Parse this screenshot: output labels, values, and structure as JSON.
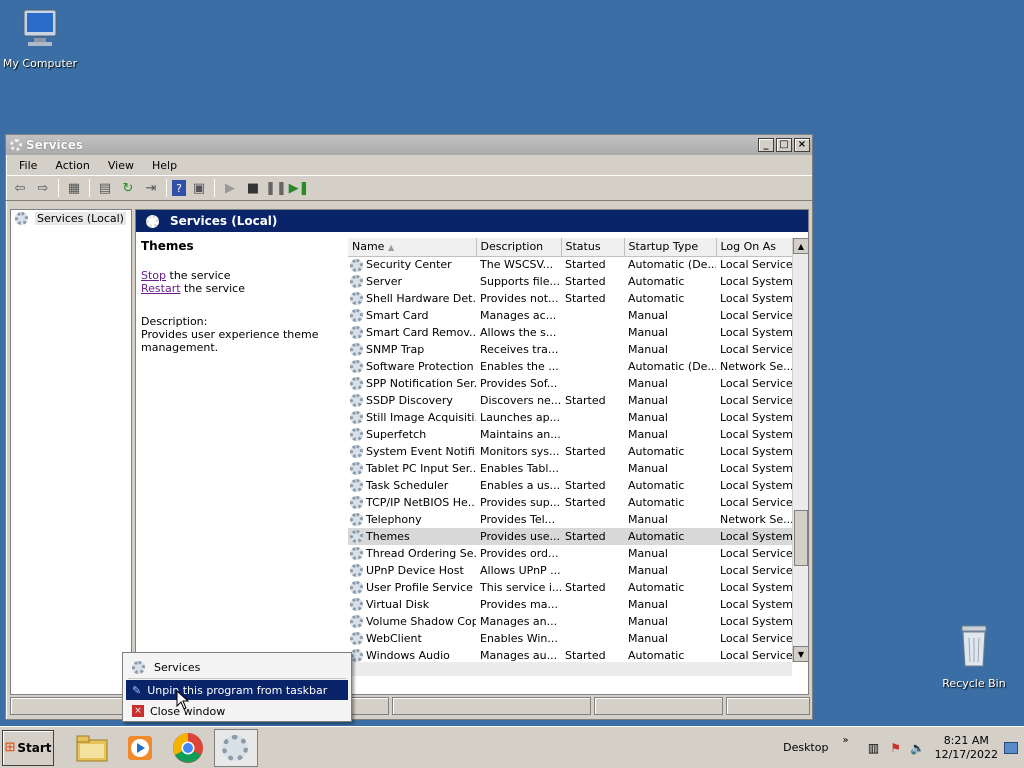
{
  "desktop": {
    "icons": [
      {
        "label": "My Computer",
        "icon": "computer-icon"
      },
      {
        "label": "Recycle Bin",
        "icon": "recycle-bin-icon"
      }
    ]
  },
  "window": {
    "title": "Services",
    "menu": [
      "File",
      "Action",
      "View",
      "Help"
    ],
    "tree_root": "Services (Local)",
    "header": "Services (Local)",
    "ext": {
      "selected_name": "Themes",
      "stop_link": "Stop",
      "stop_rest": " the service",
      "restart_link": "Restart",
      "restart_rest": " the service",
      "desc_label": "Description:",
      "desc_text": "Provides user experience theme management."
    },
    "columns": [
      "Name",
      "Description",
      "Status",
      "Startup Type",
      "Log On As"
    ],
    "rows": [
      {
        "name": "Security Center",
        "desc": "The WSCSV...",
        "status": "Started",
        "startup": "Automatic (De...",
        "logon": "Local Service"
      },
      {
        "name": "Server",
        "desc": "Supports file...",
        "status": "Started",
        "startup": "Automatic",
        "logon": "Local System"
      },
      {
        "name": "Shell Hardware Det...",
        "desc": "Provides not...",
        "status": "Started",
        "startup": "Automatic",
        "logon": "Local System"
      },
      {
        "name": "Smart Card",
        "desc": "Manages ac...",
        "status": "",
        "startup": "Manual",
        "logon": "Local Service"
      },
      {
        "name": "Smart Card Remov...",
        "desc": "Allows the s...",
        "status": "",
        "startup": "Manual",
        "logon": "Local System"
      },
      {
        "name": "SNMP Trap",
        "desc": "Receives tra...",
        "status": "",
        "startup": "Manual",
        "logon": "Local Service"
      },
      {
        "name": "Software Protection",
        "desc": "Enables the ...",
        "status": "",
        "startup": "Automatic (De...",
        "logon": "Network Se..."
      },
      {
        "name": "SPP Notification Ser...",
        "desc": "Provides Sof...",
        "status": "",
        "startup": "Manual",
        "logon": "Local Service"
      },
      {
        "name": "SSDP Discovery",
        "desc": "Discovers ne...",
        "status": "Started",
        "startup": "Manual",
        "logon": "Local Service"
      },
      {
        "name": "Still Image Acquisiti...",
        "desc": "Launches ap...",
        "status": "",
        "startup": "Manual",
        "logon": "Local System"
      },
      {
        "name": "Superfetch",
        "desc": "Maintains an...",
        "status": "",
        "startup": "Manual",
        "logon": "Local System"
      },
      {
        "name": "System Event Notifi...",
        "desc": "Monitors sys...",
        "status": "Started",
        "startup": "Automatic",
        "logon": "Local System"
      },
      {
        "name": "Tablet PC Input Ser...",
        "desc": "Enables Tabl...",
        "status": "",
        "startup": "Manual",
        "logon": "Local System"
      },
      {
        "name": "Task Scheduler",
        "desc": "Enables a us...",
        "status": "Started",
        "startup": "Automatic",
        "logon": "Local System"
      },
      {
        "name": "TCP/IP NetBIOS He...",
        "desc": "Provides sup...",
        "status": "Started",
        "startup": "Automatic",
        "logon": "Local Service"
      },
      {
        "name": "Telephony",
        "desc": "Provides Tel...",
        "status": "",
        "startup": "Manual",
        "logon": "Network Se..."
      },
      {
        "name": "Themes",
        "desc": "Provides use...",
        "status": "Started",
        "startup": "Automatic",
        "logon": "Local System"
      },
      {
        "name": "Thread Ordering Se...",
        "desc": "Provides ord...",
        "status": "",
        "startup": "Manual",
        "logon": "Local Service"
      },
      {
        "name": "UPnP Device Host",
        "desc": "Allows UPnP ...",
        "status": "",
        "startup": "Manual",
        "logon": "Local Service"
      },
      {
        "name": "User Profile Service",
        "desc": "This service i...",
        "status": "Started",
        "startup": "Automatic",
        "logon": "Local System"
      },
      {
        "name": "Virtual Disk",
        "desc": "Provides ma...",
        "status": "",
        "startup": "Manual",
        "logon": "Local System"
      },
      {
        "name": "Volume Shadow Copy",
        "desc": "Manages an...",
        "status": "",
        "startup": "Manual",
        "logon": "Local System"
      },
      {
        "name": "WebClient",
        "desc": "Enables Win...",
        "status": "",
        "startup": "Manual",
        "logon": "Local Service"
      },
      {
        "name": "Windows Audio",
        "desc": "Manages au...",
        "status": "Started",
        "startup": "Automatic",
        "logon": "Local Service"
      }
    ]
  },
  "context_menu": {
    "items": [
      "Services",
      "Unpin this program from taskbar",
      "Close window"
    ]
  },
  "taskbar": {
    "start_label": "Start",
    "desktop_label": "Desktop",
    "time": "8:21 AM",
    "date": "12/17/2022"
  }
}
